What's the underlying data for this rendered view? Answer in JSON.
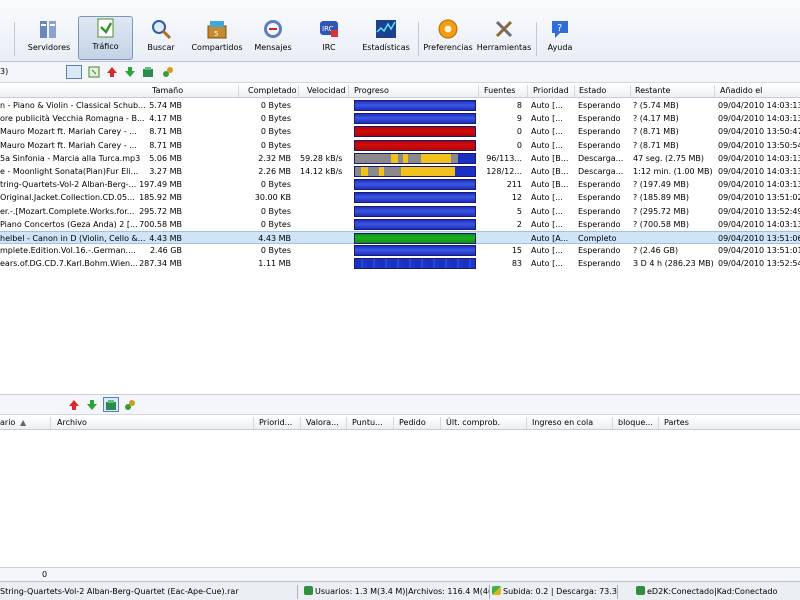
{
  "toolbar": {
    "buttons": [
      {
        "label": "Servidores",
        "icon": "servers-icon"
      },
      {
        "label": "Tráfico",
        "icon": "transfers-icon"
      },
      {
        "label": "Buscar",
        "icon": "search-icon"
      },
      {
        "label": "Compartidos",
        "icon": "shared-files-icon"
      },
      {
        "label": "Mensajes",
        "icon": "messages-icon"
      },
      {
        "label": "IRC",
        "icon": "irc-icon"
      },
      {
        "label": "Estadísticas",
        "icon": "statistics-icon"
      },
      {
        "label": "Preferencias",
        "icon": "preferences-icon"
      },
      {
        "label": "Herramientas",
        "icon": "tools-icon"
      },
      {
        "label": "Ayuda",
        "icon": "help-icon"
      }
    ],
    "active": "Tráfico"
  },
  "downloads": {
    "count_label": "3)",
    "columns": [
      "Tamaño",
      "Completado",
      "Velocidad",
      "Progreso",
      "Fuentes",
      "Prioridad",
      "Estado",
      "Restante",
      "Añadido el"
    ],
    "rows": [
      {
        "name": "n - Piano & Violin - Classical Schub...",
        "size": "5.74 MB",
        "completed": "0 Bytes",
        "speed": "",
        "progress_color": "blue",
        "sources": "8",
        "priority": "Auto [...",
        "status": "Esperando",
        "remaining": "? (5.74 MB)",
        "added": "09/04/2010 14:03:13"
      },
      {
        "name": "ore publicità Vecchia Romagna - B...",
        "size": "4.17 MB",
        "completed": "0 Bytes",
        "speed": "",
        "progress_color": "blue",
        "sources": "9",
        "priority": "Auto [...",
        "status": "Esperando",
        "remaining": "? (4.17 MB)",
        "added": "09/04/2010 14:03:13"
      },
      {
        "name": " Mauro Mozart ft. Mariah Carey - ...",
        "size": "8.71 MB",
        "completed": "0 Bytes",
        "speed": "",
        "progress_color": "red",
        "sources": "0",
        "priority": "Auto [...",
        "status": "Esperando",
        "remaining": "? (8.71 MB)",
        "added": "09/04/2010 13:50:47"
      },
      {
        "name": " Mauro Mozart ft. Mariah Carey - ...",
        "size": "8.71 MB",
        "completed": "0 Bytes",
        "speed": "",
        "progress_color": "red",
        "sources": "0",
        "priority": "Auto [...",
        "status": "Esperando",
        "remaining": "? (8.71 MB)",
        "added": "09/04/2010 13:50:54"
      },
      {
        "name": "5a Sinfonia - Marcia alla Turca.mp3",
        "size": "5.06 MB",
        "completed": "2.32 MB",
        "speed": "59.28 kB/s",
        "progress_color": "yellow-mixed",
        "sources": "96/113...",
        "priority": "Auto [B...",
        "status": "Descarga...",
        "remaining": "47 seg. (2.75 MB)",
        "added": "09/04/2010 14:03:13"
      },
      {
        "name": "e - Moonlight Sonata(Pian)Fur Eli...",
        "size": "3.27 MB",
        "completed": "2.26 MB",
        "speed": "14.12 kB/s",
        "progress_color": "yellow-full",
        "sources": "128/12...",
        "priority": "Auto [B...",
        "status": "Descarga...",
        "remaining": "1:12 min. (1.00 MB)",
        "added": "09/04/2010 14:03:13"
      },
      {
        "name": "tring-Quartets-Vol-2 Alban-Berg-...",
        "size": "197.49 MB",
        "completed": "0 Bytes",
        "speed": "",
        "progress_color": "blue",
        "sources": "211",
        "priority": "Auto [B...",
        "status": "Esperando",
        "remaining": "? (197.49 MB)",
        "added": "09/04/2010 14:03:13"
      },
      {
        "name": "Original.Jacket.Collection.CD.05...",
        "size": "185.92 MB",
        "completed": "30.00 KB",
        "speed": "",
        "progress_color": "blue",
        "sources": "12",
        "priority": "Auto [...",
        "status": "Esperando",
        "remaining": "? (185.89 MB)",
        "added": "09/04/2010 13:51:02"
      },
      {
        "name": "er.-.[Mozart.Complete.Works.for...",
        "size": "295.72 MB",
        "completed": "0 Bytes",
        "speed": "",
        "progress_color": "blue",
        "sources": "5",
        "priority": "Auto [...",
        "status": "Esperando",
        "remaining": "? (295.72 MB)",
        "added": "09/04/2010 13:52:49"
      },
      {
        "name": " Piano Concertos (Geza Anda) 2 [...",
        "size": "700.58 MB",
        "completed": "0 Bytes",
        "speed": "",
        "progress_color": "blue",
        "sources": "2",
        "priority": "Auto [...",
        "status": "Esperando",
        "remaining": "? (700.58 MB)",
        "added": "09/04/2010 14:03:13"
      },
      {
        "name": "helbel - Canon in D (Violin, Cello &...",
        "size": "4.43 MB",
        "completed": "4.43 MB",
        "speed": "",
        "progress_color": "green",
        "sources": "",
        "priority": "Auto [A...",
        "status": "Completo",
        "remaining": "",
        "added": "09/04/2010 13:51:06",
        "selected": true
      },
      {
        "name": "mplete.Edition.Vol.16.-.German....",
        "size": "2.46 GB",
        "completed": "0 Bytes",
        "speed": "",
        "progress_color": "blue",
        "sources": "15",
        "priority": "Auto [...",
        "status": "Esperando",
        "remaining": "? (2.46 GB)",
        "added": "09/04/2010 13:51:01"
      },
      {
        "name": "ears.of.DG.CD.7.Karl.Bohm.Wien...",
        "size": "287.34 MB",
        "completed": "1.11 MB",
        "speed": "",
        "progress_color": "blue-striped",
        "sources": "83",
        "priority": "Auto [...",
        "status": "Esperando",
        "remaining": "3 D 4 h (286.23 MB)",
        "added": "09/04/2010 13:52:54"
      }
    ]
  },
  "uploads": {
    "columns": [
      "ario",
      "Archivo",
      "Priorid...",
      "Valora...",
      "Puntu...",
      "Pedido",
      "Últ. comprob.",
      "Ingreso en cola",
      "bloque...",
      "Partes"
    ]
  },
  "log_strip": {
    "value": "0"
  },
  "statusbar": {
    "file": "String-Quartets-Vol-2 Alban-Berg-Quartet (Eac-Ape-Cue).rar",
    "users": "Usuarios: 1.3 M(3.4 M)|Archivos: 116.4 M(46",
    "rates": "Subida: 0.2 | Descarga: 73.3",
    "connection": "eD2K:Conectado|Kad:Conectado"
  },
  "colors": {
    "progress_blue": "#1a2fc4",
    "progress_red": "#d40b0b",
    "progress_yellow": "#f1c21b",
    "progress_gray": "#8a8a8a",
    "progress_green": "#1bb01b",
    "selected_row": "#cfe4f7"
  }
}
